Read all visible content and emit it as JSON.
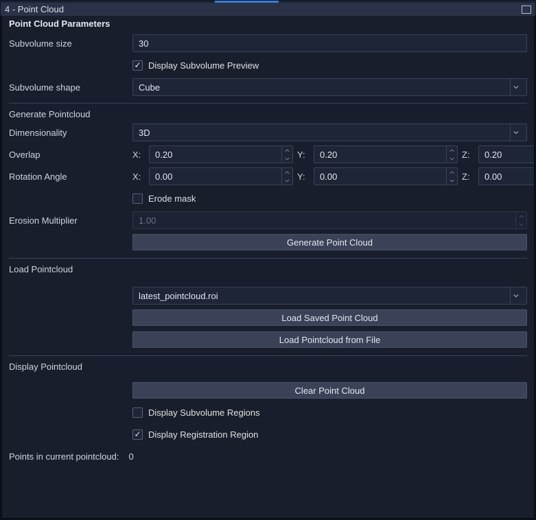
{
  "window": {
    "title": "4 - Point Cloud"
  },
  "section_title": "Point Cloud Parameters",
  "subvolume": {
    "size_label": "Subvolume size",
    "size_value": "30",
    "preview_label": "Display Subvolume Preview",
    "preview_checked": true,
    "shape_label": "Subvolume shape",
    "shape_value": "Cube"
  },
  "generate": {
    "heading": "Generate Pointcloud",
    "dim_label": "Dimensionality",
    "dim_value": "3D",
    "overlap_label": "Overlap",
    "overlap": {
      "x_label": "X:",
      "x": "0.20",
      "y_label": "Y:",
      "y": "0.20",
      "z_label": "Z:",
      "z": "0.20"
    },
    "rotation_label": "Rotation Angle",
    "rotation": {
      "x_label": "X:",
      "x": "0.00",
      "y_label": "Y:",
      "y": "0.00",
      "z_label": "Z:",
      "z": "0.00"
    },
    "erode_label": "Erode mask",
    "erode_checked": false,
    "erosion_label": "Erosion Multiplier",
    "erosion_value": "1.00",
    "generate_btn": "Generate Point Cloud"
  },
  "load": {
    "heading": "Load Pointcloud",
    "file_value": "latest_pointcloud.roi",
    "load_saved_btn": "Load Saved Point Cloud",
    "load_file_btn": "Load Pointcloud from File"
  },
  "display": {
    "heading": "Display Pointcloud",
    "clear_btn": "Clear Point Cloud",
    "regions_label": "Display Subvolume Regions",
    "regions_checked": false,
    "registration_label": "Display Registration Region",
    "registration_checked": true
  },
  "footer": {
    "points_label": "Points in current pointcloud:",
    "points_value": "0"
  }
}
